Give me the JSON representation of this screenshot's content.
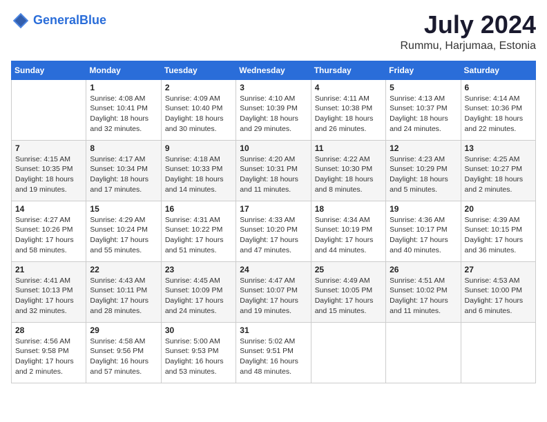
{
  "header": {
    "logo_line1": "General",
    "logo_line2": "Blue",
    "month": "July 2024",
    "location": "Rummu, Harjumaa, Estonia"
  },
  "weekdays": [
    "Sunday",
    "Monday",
    "Tuesday",
    "Wednesday",
    "Thursday",
    "Friday",
    "Saturday"
  ],
  "weeks": [
    [
      {
        "day": "",
        "sunrise": "",
        "sunset": "",
        "daylight": ""
      },
      {
        "day": "1",
        "sunrise": "Sunrise: 4:08 AM",
        "sunset": "Sunset: 10:41 PM",
        "daylight": "Daylight: 18 hours and 32 minutes."
      },
      {
        "day": "2",
        "sunrise": "Sunrise: 4:09 AM",
        "sunset": "Sunset: 10:40 PM",
        "daylight": "Daylight: 18 hours and 30 minutes."
      },
      {
        "day": "3",
        "sunrise": "Sunrise: 4:10 AM",
        "sunset": "Sunset: 10:39 PM",
        "daylight": "Daylight: 18 hours and 29 minutes."
      },
      {
        "day": "4",
        "sunrise": "Sunrise: 4:11 AM",
        "sunset": "Sunset: 10:38 PM",
        "daylight": "Daylight: 18 hours and 26 minutes."
      },
      {
        "day": "5",
        "sunrise": "Sunrise: 4:13 AM",
        "sunset": "Sunset: 10:37 PM",
        "daylight": "Daylight: 18 hours and 24 minutes."
      },
      {
        "day": "6",
        "sunrise": "Sunrise: 4:14 AM",
        "sunset": "Sunset: 10:36 PM",
        "daylight": "Daylight: 18 hours and 22 minutes."
      }
    ],
    [
      {
        "day": "7",
        "sunrise": "Sunrise: 4:15 AM",
        "sunset": "Sunset: 10:35 PM",
        "daylight": "Daylight: 18 hours and 19 minutes."
      },
      {
        "day": "8",
        "sunrise": "Sunrise: 4:17 AM",
        "sunset": "Sunset: 10:34 PM",
        "daylight": "Daylight: 18 hours and 17 minutes."
      },
      {
        "day": "9",
        "sunrise": "Sunrise: 4:18 AM",
        "sunset": "Sunset: 10:33 PM",
        "daylight": "Daylight: 18 hours and 14 minutes."
      },
      {
        "day": "10",
        "sunrise": "Sunrise: 4:20 AM",
        "sunset": "Sunset: 10:31 PM",
        "daylight": "Daylight: 18 hours and 11 minutes."
      },
      {
        "day": "11",
        "sunrise": "Sunrise: 4:22 AM",
        "sunset": "Sunset: 10:30 PM",
        "daylight": "Daylight: 18 hours and 8 minutes."
      },
      {
        "day": "12",
        "sunrise": "Sunrise: 4:23 AM",
        "sunset": "Sunset: 10:29 PM",
        "daylight": "Daylight: 18 hours and 5 minutes."
      },
      {
        "day": "13",
        "sunrise": "Sunrise: 4:25 AM",
        "sunset": "Sunset: 10:27 PM",
        "daylight": "Daylight: 18 hours and 2 minutes."
      }
    ],
    [
      {
        "day": "14",
        "sunrise": "Sunrise: 4:27 AM",
        "sunset": "Sunset: 10:26 PM",
        "daylight": "Daylight: 17 hours and 58 minutes."
      },
      {
        "day": "15",
        "sunrise": "Sunrise: 4:29 AM",
        "sunset": "Sunset: 10:24 PM",
        "daylight": "Daylight: 17 hours and 55 minutes."
      },
      {
        "day": "16",
        "sunrise": "Sunrise: 4:31 AM",
        "sunset": "Sunset: 10:22 PM",
        "daylight": "Daylight: 17 hours and 51 minutes."
      },
      {
        "day": "17",
        "sunrise": "Sunrise: 4:33 AM",
        "sunset": "Sunset: 10:20 PM",
        "daylight": "Daylight: 17 hours and 47 minutes."
      },
      {
        "day": "18",
        "sunrise": "Sunrise: 4:34 AM",
        "sunset": "Sunset: 10:19 PM",
        "daylight": "Daylight: 17 hours and 44 minutes."
      },
      {
        "day": "19",
        "sunrise": "Sunrise: 4:36 AM",
        "sunset": "Sunset: 10:17 PM",
        "daylight": "Daylight: 17 hours and 40 minutes."
      },
      {
        "day": "20",
        "sunrise": "Sunrise: 4:39 AM",
        "sunset": "Sunset: 10:15 PM",
        "daylight": "Daylight: 17 hours and 36 minutes."
      }
    ],
    [
      {
        "day": "21",
        "sunrise": "Sunrise: 4:41 AM",
        "sunset": "Sunset: 10:13 PM",
        "daylight": "Daylight: 17 hours and 32 minutes."
      },
      {
        "day": "22",
        "sunrise": "Sunrise: 4:43 AM",
        "sunset": "Sunset: 10:11 PM",
        "daylight": "Daylight: 17 hours and 28 minutes."
      },
      {
        "day": "23",
        "sunrise": "Sunrise: 4:45 AM",
        "sunset": "Sunset: 10:09 PM",
        "daylight": "Daylight: 17 hours and 24 minutes."
      },
      {
        "day": "24",
        "sunrise": "Sunrise: 4:47 AM",
        "sunset": "Sunset: 10:07 PM",
        "daylight": "Daylight: 17 hours and 19 minutes."
      },
      {
        "day": "25",
        "sunrise": "Sunrise: 4:49 AM",
        "sunset": "Sunset: 10:05 PM",
        "daylight": "Daylight: 17 hours and 15 minutes."
      },
      {
        "day": "26",
        "sunrise": "Sunrise: 4:51 AM",
        "sunset": "Sunset: 10:02 PM",
        "daylight": "Daylight: 17 hours and 11 minutes."
      },
      {
        "day": "27",
        "sunrise": "Sunrise: 4:53 AM",
        "sunset": "Sunset: 10:00 PM",
        "daylight": "Daylight: 17 hours and 6 minutes."
      }
    ],
    [
      {
        "day": "28",
        "sunrise": "Sunrise: 4:56 AM",
        "sunset": "Sunset: 9:58 PM",
        "daylight": "Daylight: 17 hours and 2 minutes."
      },
      {
        "day": "29",
        "sunrise": "Sunrise: 4:58 AM",
        "sunset": "Sunset: 9:56 PM",
        "daylight": "Daylight: 16 hours and 57 minutes."
      },
      {
        "day": "30",
        "sunrise": "Sunrise: 5:00 AM",
        "sunset": "Sunset: 9:53 PM",
        "daylight": "Daylight: 16 hours and 53 minutes."
      },
      {
        "day": "31",
        "sunrise": "Sunrise: 5:02 AM",
        "sunset": "Sunset: 9:51 PM",
        "daylight": "Daylight: 16 hours and 48 minutes."
      },
      {
        "day": "",
        "sunrise": "",
        "sunset": "",
        "daylight": ""
      },
      {
        "day": "",
        "sunrise": "",
        "sunset": "",
        "daylight": ""
      },
      {
        "day": "",
        "sunrise": "",
        "sunset": "",
        "daylight": ""
      }
    ]
  ]
}
